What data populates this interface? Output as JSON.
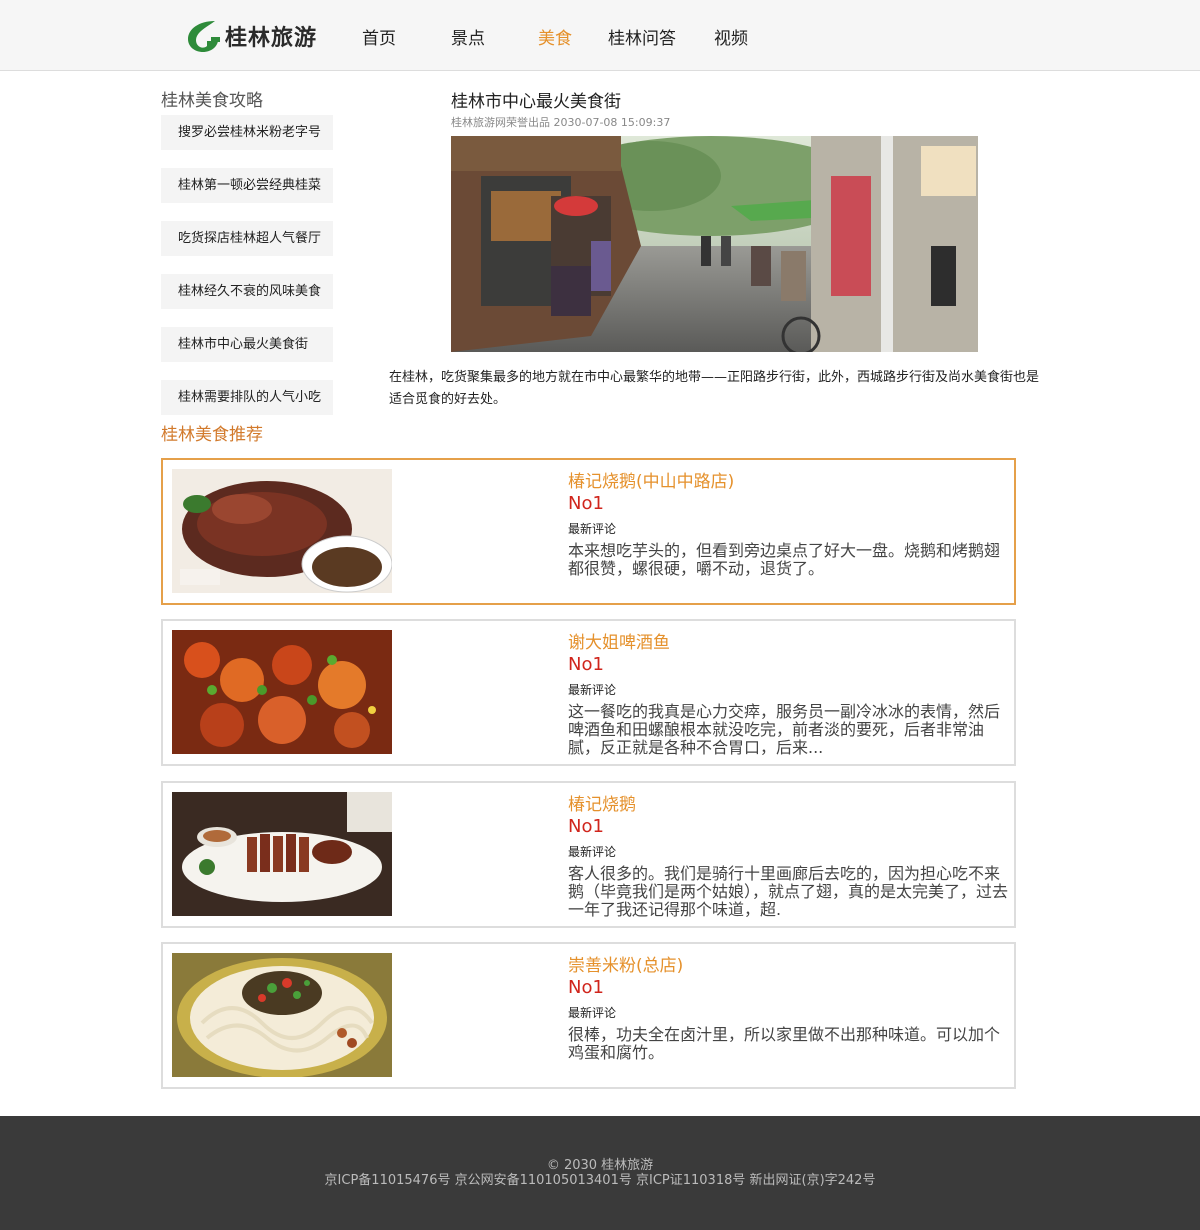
{
  "header": {
    "logo_text": "桂林旅游",
    "nav": [
      "首页",
      "景点",
      "美食",
      "桂林问答",
      "视频"
    ],
    "active_nav": "美食"
  },
  "sidebar": {
    "title": "桂林美食攻略",
    "items": [
      "搜罗必尝桂林米粉老字号",
      "桂林第一顿必尝经典桂菜",
      "吃货探店桂林超人气餐厅",
      "桂林经久不衰的风味美食",
      "桂林市中心最火美食街",
      "桂林需要排队的人气小吃"
    ]
  },
  "article": {
    "title": "桂林市中心最火美食街",
    "meta": "桂林旅游网荣誉出品 2030-07-08 15:09:37",
    "image_icon": "food-street-photo",
    "body": "在桂林，吃货聚集最多的地方就在市中心最繁华的地带——正阳路步行街，此外，西城路步行街及尚水美食街也是适合觅食的好去处。"
  },
  "recommend": {
    "title": "桂林美食推荐",
    "cards": [
      {
        "name": "椿记烧鹅(中山中路店)",
        "rank": "No1",
        "label": "最新评论",
        "review": "本来想吃芋头的，但看到旁边桌点了好大一盘。烧鹅和烤鹅翅都很赞，螺很硬，嚼不动，退货了。",
        "image_icon": "roast-goose-photo"
      },
      {
        "name": "谢大姐啤酒鱼",
        "rank": "No1",
        "label": "最新评论",
        "review": "这一餐吃的我真是心力交瘁，服务员一副冷冰冰的表情，然后啤酒鱼和田螺酿根本就没吃完，前者淡的要死，后者非常油腻，反正就是各种不合胃口，后来...",
        "image_icon": "beer-fish-photo"
      },
      {
        "name": "椿记烧鹅",
        "rank": "No1",
        "label": "最新评论",
        "review": "客人很多的。我们是骑行十里画廊后去吃的，因为担心吃不来鹅（毕竟我们是两个姑娘），就点了翅，真的是太完美了，过去一年了我还记得那个味道，超.",
        "image_icon": "sliced-goose-photo"
      },
      {
        "name": "崇善米粉(总店)",
        "rank": "No1",
        "label": "最新评论",
        "review": "很棒，功夫全在卤汁里，所以家里做不出那种味道。可以加个鸡蛋和腐竹。",
        "image_icon": "rice-noodle-photo"
      }
    ]
  },
  "footer": {
    "copyright": "© 2030 桂林旅游",
    "licenses": "京ICP备11015476号 京公网安备110105013401号 京ICP证110318号 新出网证(京)字242号"
  },
  "colors": {
    "accent": "#e5912c",
    "rank": "#d0251c",
    "card_highlight": "#e5a04a",
    "footer_bg": "#3a3a3a",
    "logo_green": "#2e8b3a"
  }
}
